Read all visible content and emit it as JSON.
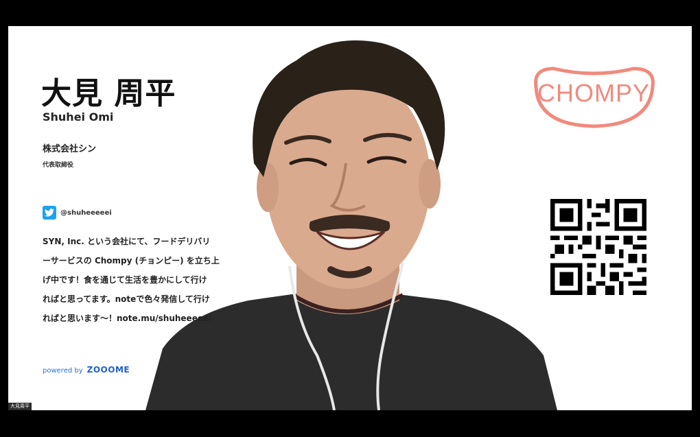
{
  "profile": {
    "name_jp": "大見 周平",
    "name_en": "Shuhei Omi",
    "company": "株式会社シン",
    "job_title": "代表取締役",
    "twitter_handle": "@shuheeeeei",
    "bio_lines": [
      "SYN, Inc. という会社にて、フードデリバリ",
      "ーサービスの Chompy (チョンピー) を立ち上",
      "げ中です！食を通じて生活を豊かにして行け",
      "ればと思ってます。noteで色々発信して行け",
      "ればと思います〜！note.mu/shuheeeeei"
    ]
  },
  "branding": {
    "powered_by_label": "powered by",
    "powered_by_brand": "ZOOOME",
    "logo_text": "CHOMPY",
    "logo_color": "#f08a7d",
    "twitter_color": "#1da1f2"
  },
  "participant": {
    "name": "大見周平"
  },
  "icons": [
    "twitter-icon",
    "qr-code-icon"
  ]
}
